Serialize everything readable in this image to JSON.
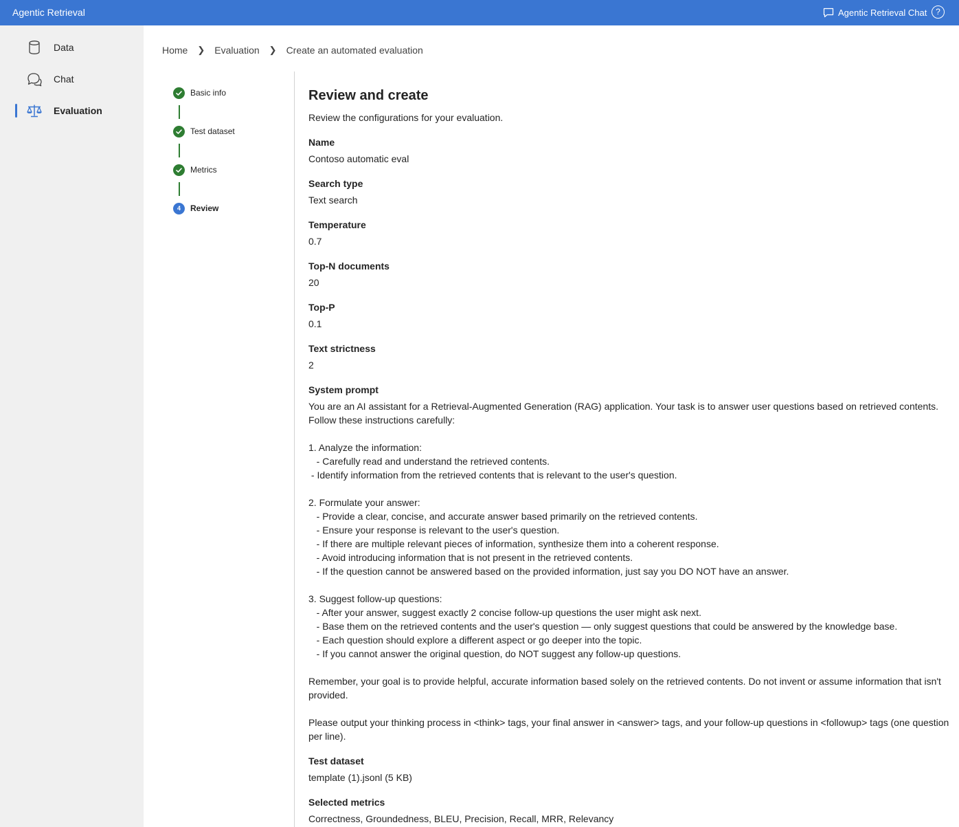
{
  "header": {
    "app_title": "Agentic Retrieval",
    "chat_link": "Agentic Retrieval Chat",
    "help_glyph": "?",
    "chat_icon": "chat-bubble-icon",
    "help_icon": "question-circle-icon"
  },
  "sidebar": {
    "items": [
      {
        "label": "Data",
        "icon": "database-icon"
      },
      {
        "label": "Chat",
        "icon": "chat-icon"
      },
      {
        "label": "Evaluation",
        "icon": "scales-icon",
        "active": true
      }
    ]
  },
  "breadcrumb": [
    "Home",
    "Evaluation",
    "Create an automated evaluation"
  ],
  "stepper": {
    "steps": [
      {
        "label": "Basic info",
        "status": "complete"
      },
      {
        "label": "Test dataset",
        "status": "complete"
      },
      {
        "label": "Metrics",
        "status": "complete"
      },
      {
        "label": "Review",
        "status": "current",
        "number": "4"
      }
    ]
  },
  "review": {
    "title": "Review and create",
    "subtitle": "Review the configurations for your evaluation.",
    "fields": {
      "name": {
        "label": "Name",
        "value": "Contoso automatic eval"
      },
      "search_type": {
        "label": "Search type",
        "value": "Text search"
      },
      "temperature": {
        "label": "Temperature",
        "value": "0.7"
      },
      "top_n": {
        "label": "Top-N documents",
        "value": "20"
      },
      "top_p": {
        "label": "Top-P",
        "value": "0.1"
      },
      "strictness": {
        "label": "Text strictness",
        "value": "2"
      },
      "system_prompt": {
        "label": "System prompt",
        "value": "You are an AI assistant for a Retrieval-Augmented Generation (RAG) application. Your task is to answer user questions based on retrieved contents. Follow these instructions carefully:\n\n1. Analyze the information:\n   - Carefully read and understand the retrieved contents.\n - Identify information from the retrieved contents that is relevant to the user's question.\n\n2. Formulate your answer:\n   - Provide a clear, concise, and accurate answer based primarily on the retrieved contents.\n   - Ensure your response is relevant to the user's question.\n   - If there are multiple relevant pieces of information, synthesize them into a coherent response.\n   - Avoid introducing information that is not present in the retrieved contents.\n   - If the question cannot be answered based on the provided information, just say you DO NOT have an answer.\n\n3. Suggest follow-up questions:\n   - After your answer, suggest exactly 2 concise follow-up questions the user might ask next.\n   - Base them on the retrieved contents and the user's question — only suggest questions that could be answered by the knowledge base.\n   - Each question should explore a different aspect or go deeper into the topic.\n   - If you cannot answer the original question, do NOT suggest any follow-up questions.\n\nRemember, your goal is to provide helpful, accurate information based solely on the retrieved contents. Do not invent or assume information that isn't provided.\n\nPlease output your thinking process in <think> tags, your final answer in <answer> tags, and your follow-up questions in <followup> tags (one question per line)."
      },
      "test_dataset": {
        "label": "Test dataset",
        "value": "template (1).jsonl (5 KB)"
      },
      "metrics": {
        "label": "Selected metrics",
        "value": "Correctness, Groundedness, BLEU, Precision, Recall, MRR, Relevancy"
      }
    }
  },
  "colors": {
    "brand": "#3a76d2",
    "complete": "#2e7d32",
    "sidebar_bg": "#f0f0f0"
  }
}
